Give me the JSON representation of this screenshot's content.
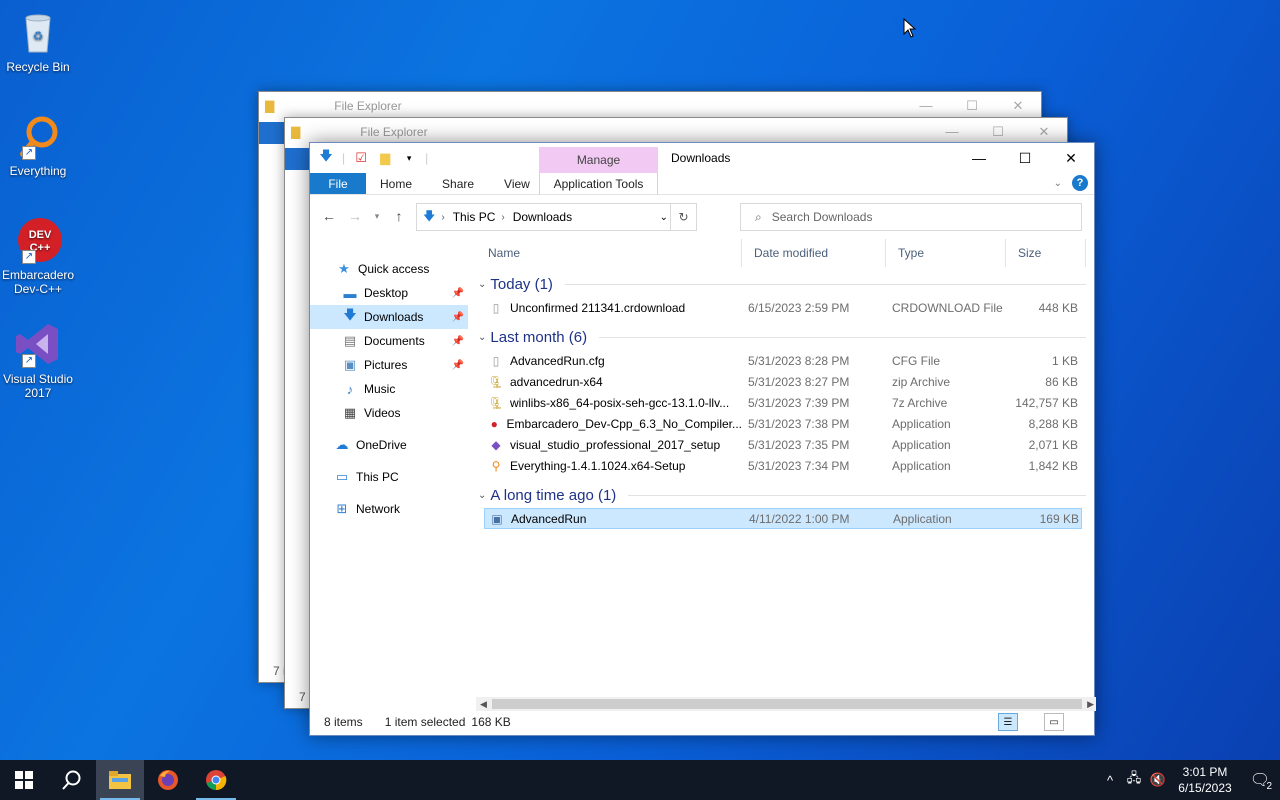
{
  "desktop": {
    "icons": [
      {
        "label": "Recycle Bin",
        "icon": "recycle-bin-icon"
      },
      {
        "label": "Everything",
        "icon": "magnifier-icon"
      },
      {
        "label": "Embarcadero Dev-C++",
        "badge": "DEV C++",
        "icon": "devcpp-icon"
      },
      {
        "label": "Visual Studio 2017",
        "icon": "visual-studio-icon"
      }
    ]
  },
  "background_windows": [
    {
      "title": "File Explorer",
      "status": "7 i"
    },
    {
      "title": "File Explorer",
      "status": "7 i"
    }
  ],
  "explorer": {
    "title": "Downloads",
    "manage_tab": "Manage",
    "app_tools_tab": "Application Tools",
    "ribbon_tabs": [
      "File",
      "Home",
      "Share",
      "View"
    ],
    "breadcrumb": [
      "This PC",
      "Downloads"
    ],
    "search_placeholder": "Search Downloads",
    "nav": [
      {
        "label": "Quick access",
        "icon": "star-icon",
        "pinned": false
      },
      {
        "label": "Desktop",
        "icon": "desktop-icon",
        "pinned": true
      },
      {
        "label": "Downloads",
        "icon": "download-icon",
        "pinned": true,
        "selected": true
      },
      {
        "label": "Documents",
        "icon": "documents-icon",
        "pinned": true
      },
      {
        "label": "Pictures",
        "icon": "pictures-icon",
        "pinned": true
      },
      {
        "label": "Music",
        "icon": "music-icon",
        "pinned": false
      },
      {
        "label": "Videos",
        "icon": "videos-icon",
        "pinned": false
      },
      {
        "label": "OneDrive",
        "icon": "cloud-icon",
        "pinned": false
      },
      {
        "label": "This PC",
        "icon": "computer-icon",
        "pinned": false
      },
      {
        "label": "Network",
        "icon": "network-icon",
        "pinned": false
      }
    ],
    "columns": [
      "Name",
      "Date modified",
      "Type",
      "Size"
    ],
    "groups": [
      {
        "label": "Today (1)",
        "rows": [
          {
            "name": "Unconfirmed 211341.crdownload",
            "date": "6/15/2023 2:59 PM",
            "type": "CRDOWNLOAD File",
            "size": "448 KB",
            "icon": "file-icon"
          }
        ]
      },
      {
        "label": "Last month (6)",
        "rows": [
          {
            "name": "AdvancedRun.cfg",
            "date": "5/31/2023 8:28 PM",
            "type": "CFG File",
            "size": "1 KB",
            "icon": "file-icon"
          },
          {
            "name": "advancedrun-x64",
            "date": "5/31/2023 8:27 PM",
            "type": "zip Archive",
            "size": "86 KB",
            "icon": "archive-icon"
          },
          {
            "name": "winlibs-x86_64-posix-seh-gcc-13.1.0-llv...",
            "date": "5/31/2023 7:39 PM",
            "type": "7z Archive",
            "size": "142,757 KB",
            "icon": "archive-icon"
          },
          {
            "name": "Embarcadero_Dev-Cpp_6.3_No_Compiler...",
            "date": "5/31/2023 7:38 PM",
            "type": "Application",
            "size": "8,288 KB",
            "icon": "devcpp-icon"
          },
          {
            "name": "visual_studio_professional_2017_setup",
            "date": "5/31/2023 7:35 PM",
            "type": "Application",
            "size": "2,071 KB",
            "icon": "visual-studio-icon"
          },
          {
            "name": "Everything-1.4.1.1024.x64-Setup",
            "date": "5/31/2023 7:34 PM",
            "type": "Application",
            "size": "1,842 KB",
            "icon": "magnifier-icon"
          }
        ]
      },
      {
        "label": "A long time ago (1)",
        "rows": [
          {
            "name": "AdvancedRun",
            "date": "4/11/2022 1:00 PM",
            "type": "Application",
            "size": "169 KB",
            "icon": "app-window-icon",
            "selected": true
          }
        ]
      }
    ],
    "status": {
      "items": "8 items",
      "selected": "1 item selected",
      "size": "168 KB"
    }
  },
  "taskbar": {
    "time": "3:01 PM",
    "date": "6/15/2023",
    "notifications": "2"
  }
}
